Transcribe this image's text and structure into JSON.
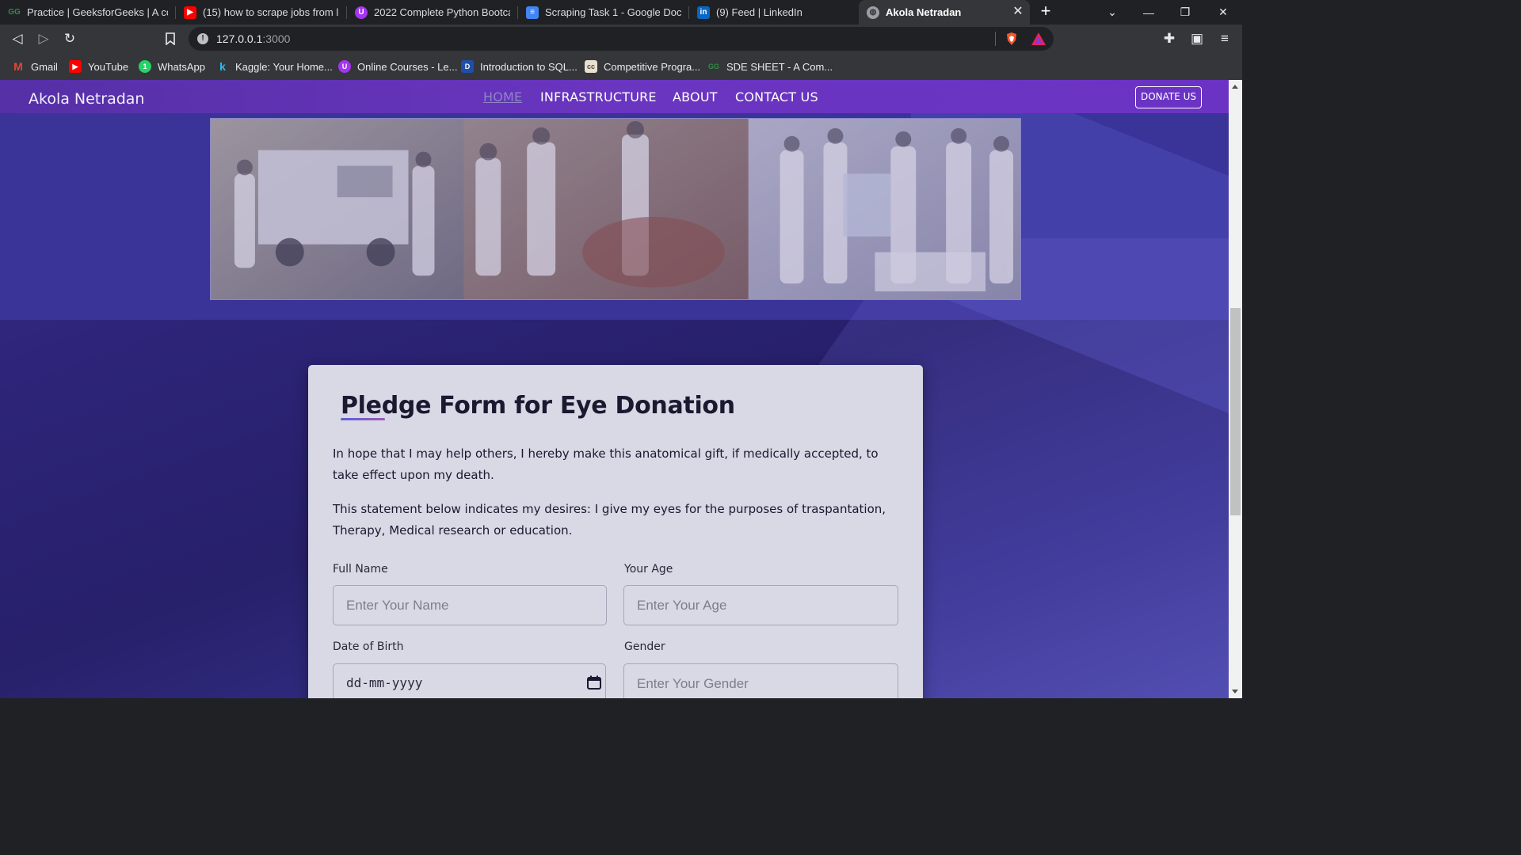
{
  "browser": {
    "tabs": [
      {
        "label": "Practice | GeeksforGeeks | A comp",
        "icon": "geeksforgeeks-icon"
      },
      {
        "label": "(15) how to scrape jobs from linke",
        "icon": "youtube-icon"
      },
      {
        "label": "2022 Complete Python Bootcamp",
        "icon": "udemy-icon"
      },
      {
        "label": "Scraping Task 1 - Google Docs",
        "icon": "google-docs-icon"
      },
      {
        "label": "(9) Feed | LinkedIn",
        "icon": "linkedin-icon"
      },
      {
        "label": "Akola Netradan",
        "icon": "globe-icon",
        "active": true
      }
    ],
    "url_host": "127.0.0.1",
    "url_port": ":3000",
    "bookmarks": [
      {
        "label": "Gmail",
        "icon": "gmail-icon"
      },
      {
        "label": "YouTube",
        "icon": "youtube-icon"
      },
      {
        "label": "WhatsApp",
        "icon": "whatsapp-icon"
      },
      {
        "label": "Kaggle: Your Home...",
        "icon": "kaggle-icon"
      },
      {
        "label": "Online Courses - Le...",
        "icon": "udemy-icon"
      },
      {
        "label": "Introduction to SQL...",
        "icon": "datacamp-icon"
      },
      {
        "label": "Competitive Progra...",
        "icon": "codechef-icon"
      },
      {
        "label": "SDE SHEET - A Com...",
        "icon": "geeksforgeeks-icon"
      }
    ]
  },
  "site": {
    "brand": "Akola Netradan",
    "nav": {
      "home": "HOME",
      "infrastructure": "INFRASTRUCTURE",
      "about": "ABOUT",
      "contact": "CONTACT US",
      "donate": "DONATE US"
    },
    "colors": {
      "navbar": "#6a35c0",
      "page_bg": "#2d2478",
      "card": "#d9d8e5"
    }
  },
  "form": {
    "title": "Pledge Form for Eye Donation",
    "para1": "In hope that I may help others, I hereby make this anatomical gift, if medically accepted, to take effect upon my death.",
    "para2": "This statement below indicates my desires: I give my eyes for the purposes of traspantation, Therapy, Medical research or education.",
    "full_name": {
      "label": "Full Name",
      "placeholder": "Enter Your Name"
    },
    "age": {
      "label": "Your Age",
      "placeholder": "Enter Your Age"
    },
    "dob": {
      "label": "Date of Birth",
      "value": "dd-mm-yyyy"
    },
    "gender": {
      "label": "Gender",
      "placeholder": "Enter Your Gender"
    }
  }
}
